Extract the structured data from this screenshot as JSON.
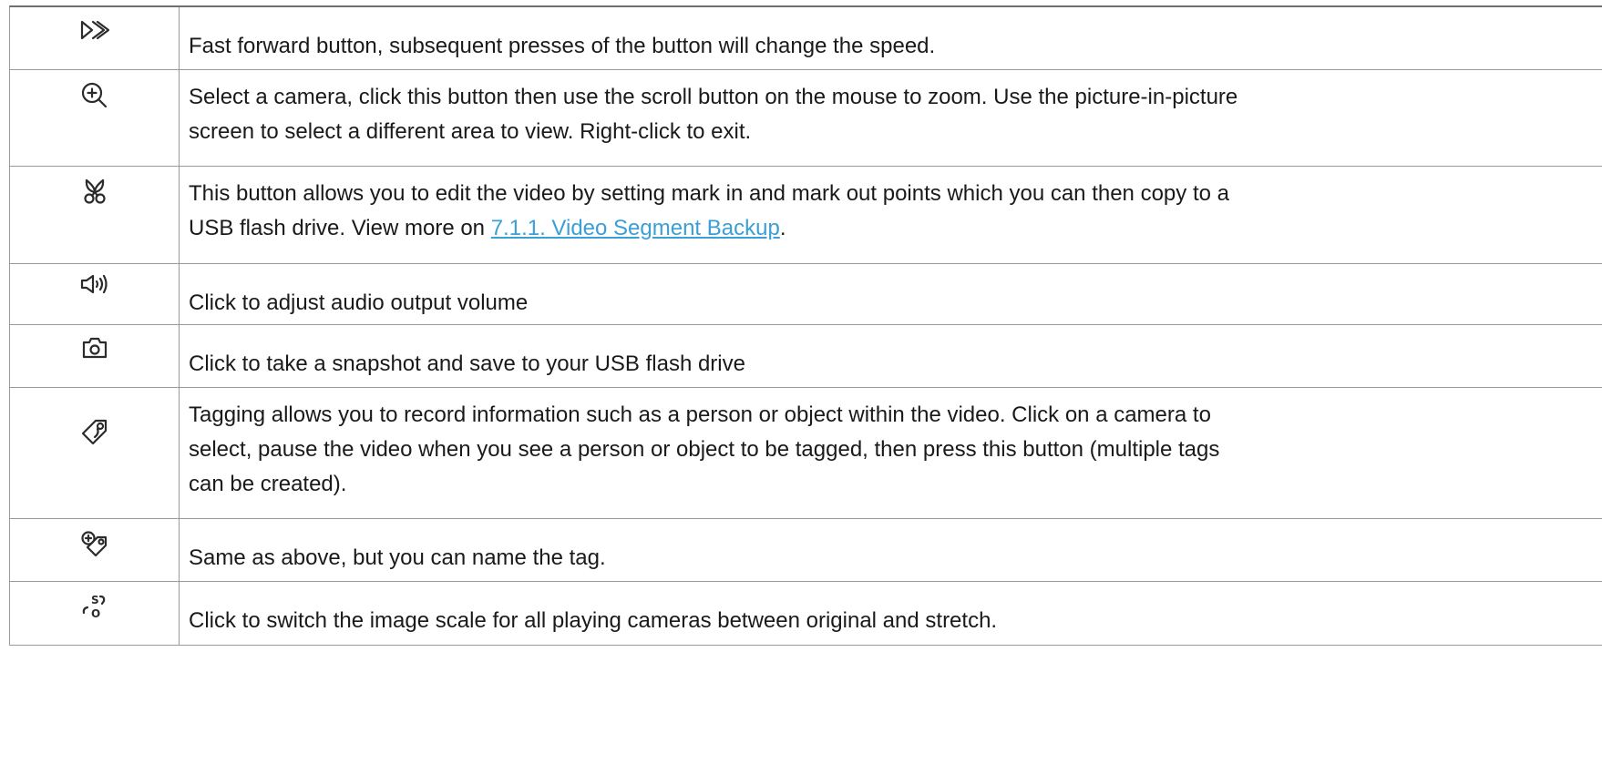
{
  "rows": [
    {
      "icon": "fast-forward-icon",
      "text": "Fast forward button, subsequent presses of the button will change the speed."
    },
    {
      "icon": "zoom-in-icon",
      "line1": "Select a camera, click this button then use the scroll button on the mouse to zoom. Use the picture-in-picture",
      "line2": "screen to select a different area to view. Right-click to exit."
    },
    {
      "icon": "scissors-icon",
      "line1": "This button allows you to edit the video by setting mark in and mark out points which you can then copy to a",
      "line2_prefix": "USB flash drive. View more on ",
      "link": "7.1.1. Video Segment Backup",
      "line2_suffix": "."
    },
    {
      "icon": "speaker-volume-icon",
      "text": "Click to adjust audio output volume"
    },
    {
      "icon": "camera-snapshot-icon",
      "text": "Click to take a snapshot and save to your USB flash drive"
    },
    {
      "icon": "tag-icon",
      "line1": "Tagging allows you to record information such as a person or object within the video. Click on a camera to",
      "line2": "select, pause the video when you see a person or object to be tagged, then press this button (multiple tags",
      "line3": "can be created)."
    },
    {
      "icon": "add-named-tag-icon",
      "text": "Same as above, but you can name the tag."
    },
    {
      "icon": "image-scale-icon",
      "text": "Click to switch the image scale for all playing cameras between original and stretch.",
      "icon_glyphs": "S O"
    }
  ],
  "colors": {
    "link": "#3a9fd6",
    "border": "#9a9a9a",
    "text": "#1a1a1a"
  }
}
